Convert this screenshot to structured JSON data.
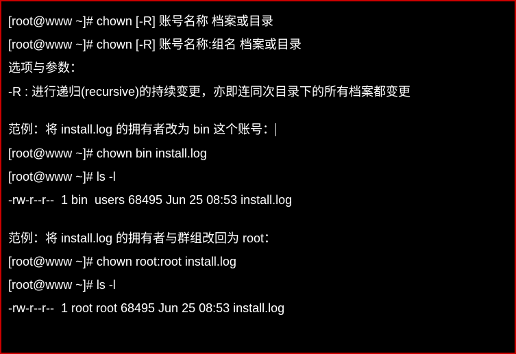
{
  "terminal": {
    "lines": [
      "[root@www ~]# chown [-R] 账号名称 档案或目录",
      "[root@www ~]# chown [-R] 账号名称:组名 档案或目录",
      "选项与参数：",
      "-R : 进行递归(recursive)的持续变更，亦即连同次目录下的所有档案都变更",
      "",
      "范例：将 install.log 的拥有者改为 bin 这个账号：",
      "[root@www ~]# chown bin install.log",
      "[root@www ~]# ls -l",
      "-rw-r--r--  1 bin  users 68495 Jun 25 08:53 install.log",
      "",
      "范例：将 install.log 的拥有者与群组改回为 root：",
      "[root@www ~]# chown root:root install.log",
      "[root@www ~]# ls -l",
      "-rw-r--r--  1 root root 68495 Jun 25 08:53 install.log"
    ],
    "cursor_line_index": 5
  }
}
